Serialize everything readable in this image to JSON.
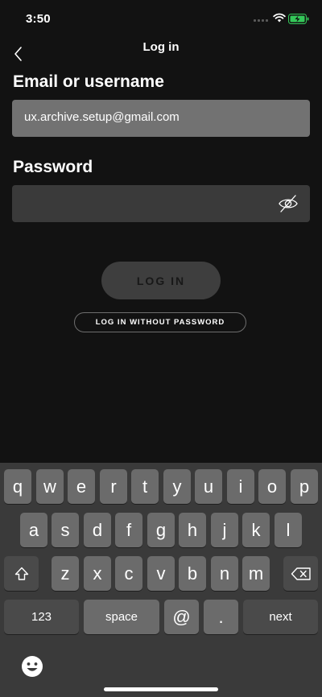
{
  "status": {
    "time": "3:50"
  },
  "nav": {
    "title": "Log in"
  },
  "form": {
    "email_label": "Email or username",
    "email_value": "ux.archive.setup@gmail.com",
    "password_label": "Password",
    "password_value": ""
  },
  "buttons": {
    "login": "LOG IN",
    "login_without_password": "LOG IN WITHOUT PASSWORD"
  },
  "keyboard": {
    "row1": [
      "q",
      "w",
      "e",
      "r",
      "t",
      "y",
      "u",
      "i",
      "o",
      "p"
    ],
    "row2": [
      "a",
      "s",
      "d",
      "f",
      "g",
      "h",
      "j",
      "k",
      "l"
    ],
    "row3": [
      "z",
      "x",
      "c",
      "v",
      "b",
      "n",
      "m"
    ],
    "numbers": "123",
    "space": "space",
    "at": "@",
    "period": ".",
    "next": "next"
  },
  "icons": {
    "back": "chevron-left-icon",
    "eye": "eye-slash-icon",
    "shift": "shift-icon",
    "delete": "backspace-icon",
    "emoji": "emoji-icon"
  },
  "colors": {
    "background": "#121212",
    "field_active": "#727272",
    "field_inactive": "#3a3a3a",
    "battery": "#34c759"
  }
}
